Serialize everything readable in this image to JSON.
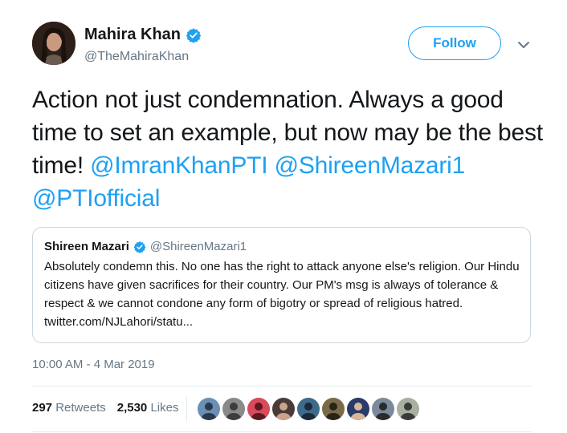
{
  "author": {
    "name": "Mahira Khan",
    "handle": "@TheMahiraKhan",
    "verified_icon": "verified-badge-icon"
  },
  "follow_label": "Follow",
  "tweet": {
    "text_before": "Action not just condemnation. Always a good time to set an example, but now may be the best time! ",
    "mentions": [
      "@ImranKhanPTI",
      "@ShireenMazari1",
      "@PTIofficial"
    ]
  },
  "quote": {
    "name": "Shireen Mazari",
    "handle": "@ShireenMazari1",
    "text": "Absolutely condemn this. No one has the right to attack anyone else's religion. Our Hindu citizens have given sacrifices for their country. Our PM's msg is always of tolerance & respect & we cannot condone any form of bigotry or spread of religious hatred. twitter.com/NJLahori/statu..."
  },
  "timestamp": "10:00 AM - 4 Mar 2019",
  "stats": {
    "retweets_count": "297",
    "retweets_label": "Retweets",
    "likes_count": "2,530",
    "likes_label": "Likes"
  },
  "colors": {
    "accent": "#1da1f2",
    "text": "#14171a",
    "muted": "#657786",
    "border": "#ccd6dd"
  },
  "liker_avatars": [
    {
      "bg": "#6b8fb5",
      "fg": "#2b3a4a"
    },
    {
      "bg": "#8a8a8a",
      "fg": "#3d3d3d"
    },
    {
      "bg": "#d94a5a",
      "fg": "#5a1a22"
    },
    {
      "bg": "#4a3a3a",
      "fg": "#c9a48a"
    },
    {
      "bg": "#3f6a8a",
      "fg": "#1a2a3a"
    },
    {
      "bg": "#7a6a4a",
      "fg": "#2a2418"
    },
    {
      "bg": "#2a3a6a",
      "fg": "#d8b89a"
    },
    {
      "bg": "#7a8a9a",
      "fg": "#2a2a2a"
    },
    {
      "bg": "#a8b0a0",
      "fg": "#3a3a3a"
    }
  ]
}
